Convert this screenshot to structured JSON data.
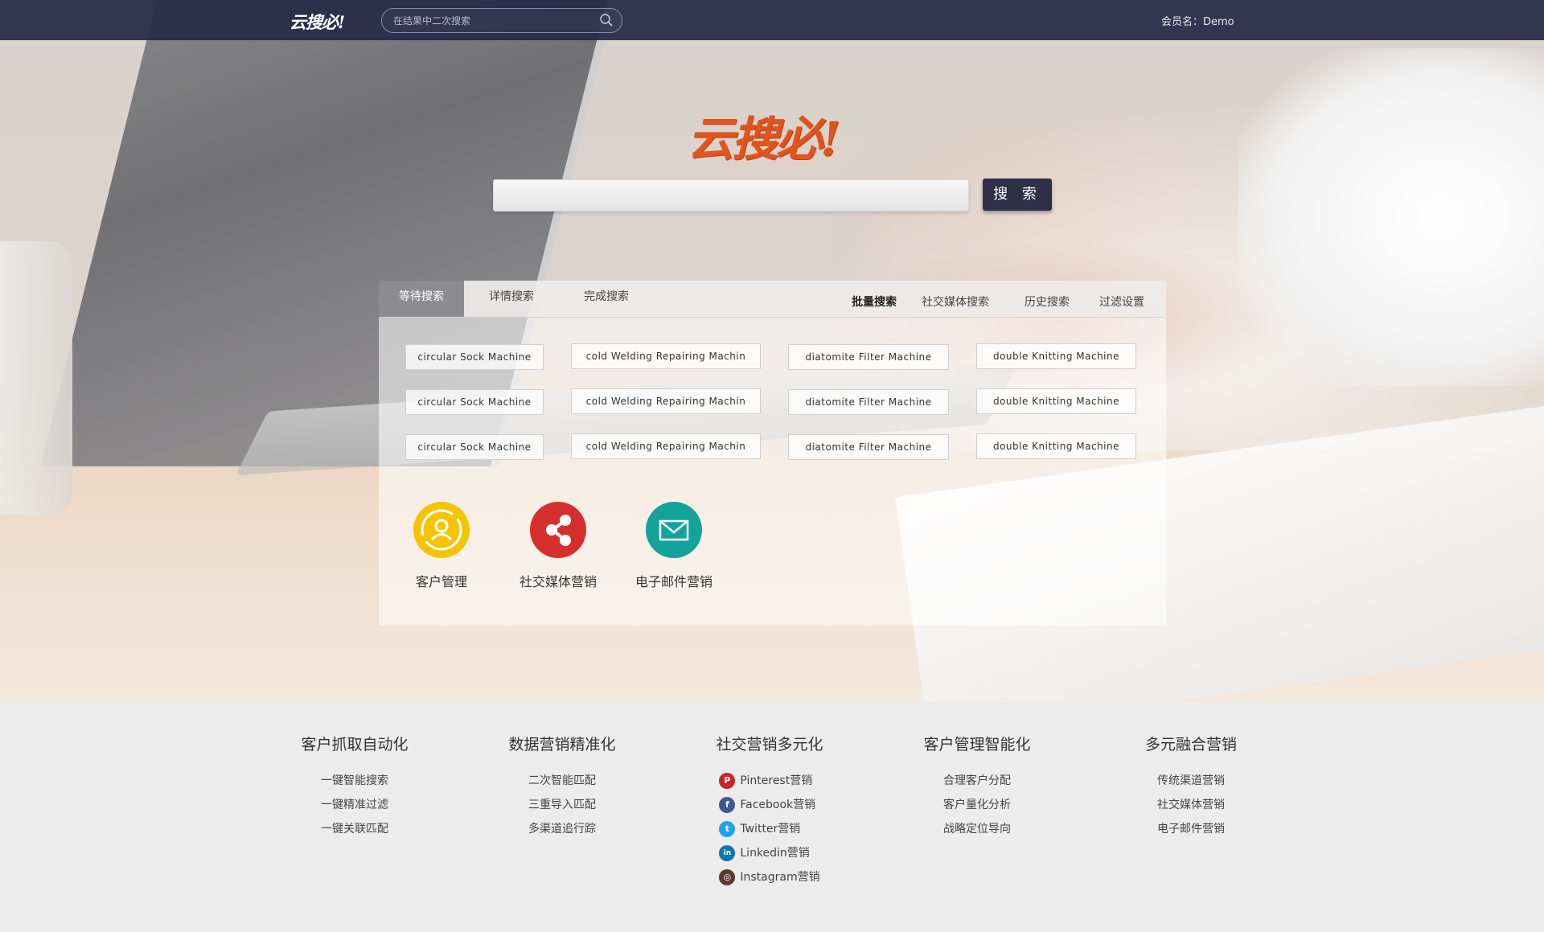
{
  "topbar": {
    "logo": "云搜必!",
    "search_placeholder": "在结果中二次搜索",
    "member_label": "会员名：Demo"
  },
  "brand": {
    "logo": "云搜必!"
  },
  "search": {
    "placeholder": "",
    "button_label": "搜 索"
  },
  "tabs": {
    "left": [
      "等待搜索",
      "详情搜索",
      "完成搜索"
    ],
    "right": [
      "批量搜索",
      "社交媒体搜索",
      "历史搜索",
      "过滤设置"
    ],
    "active_left": "等待搜索",
    "active_right": "批量搜索"
  },
  "tag_rows": [
    [
      "circular Sock Machine",
      "cold Welding Repairing Machin",
      "diatomite Filter Machine",
      "double Knitting Machine"
    ],
    [
      "circular Sock Machine",
      "cold Welding Repairing Machin",
      "diatomite Filter Machine",
      "double Knitting Machine"
    ],
    [
      "circular Sock Machine",
      "cold Welding Repairing Machin",
      "diatomite Filter Machine",
      "double Knitting Machine"
    ]
  ],
  "features": [
    {
      "label": "客户管理",
      "icon": "customer-icon",
      "color": "#f5c400"
    },
    {
      "label": "社交媒体营销",
      "icon": "share-icon",
      "color": "#d62f2b"
    },
    {
      "label": "电子邮件营销",
      "icon": "mail-icon",
      "color": "#14a39c"
    }
  ],
  "footer": {
    "columns": [
      {
        "title": "客户抓取自动化",
        "items": [
          "一键智能搜索",
          "一键精准过滤",
          "一键关联匹配"
        ]
      },
      {
        "title": "数据营销精准化",
        "items": [
          "二次智能匹配",
          "三重导入匹配",
          "多渠道追行踪"
        ]
      },
      {
        "title": "社交营销多元化",
        "items": [
          "Pinterest营销",
          "Facebook营销",
          "Twitter营销",
          "Linkedin营销",
          "Instagram营销"
        ]
      },
      {
        "title": "客户管理智能化",
        "items": [
          "合理客户分配",
          "客户量化分析",
          "战略定位导向"
        ]
      },
      {
        "title": "多元融合营销",
        "items": [
          "传统渠道营销",
          "社交媒体营销",
          "电子邮件营销"
        ]
      }
    ],
    "social_icons": [
      {
        "name": "pinterest-icon",
        "glyph": "P",
        "color": "#c8232c"
      },
      {
        "name": "facebook-icon",
        "glyph": "f",
        "color": "#3b5998"
      },
      {
        "name": "twitter-icon",
        "glyph": "t",
        "color": "#1da1f2"
      },
      {
        "name": "linkedin-icon",
        "glyph": "in",
        "color": "#0e76a8"
      },
      {
        "name": "instagram-icon",
        "glyph": "◎",
        "color": "#5b3a29"
      }
    ]
  }
}
